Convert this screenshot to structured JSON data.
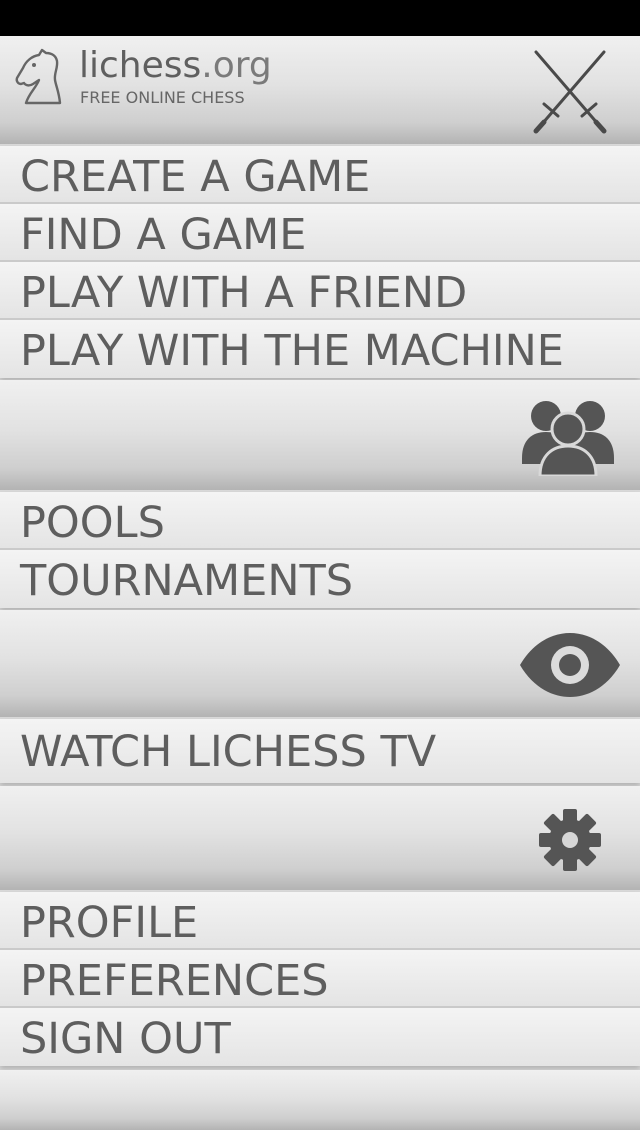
{
  "header": {
    "logo_name": "lichess",
    "logo_ext": ".org",
    "tagline": "FREE ONLINE CHESS",
    "logo_icon": "knight-icon",
    "action_icon": "crossed-swords-icon"
  },
  "play_menu": {
    "items": [
      {
        "label": "CREATE A GAME"
      },
      {
        "label": "FIND A GAME"
      },
      {
        "label": "PLAY WITH A FRIEND"
      },
      {
        "label": "PLAY WITH THE MACHINE"
      }
    ]
  },
  "community_section": {
    "icon": "users-icon",
    "items": [
      {
        "label": "POOLS"
      },
      {
        "label": "TOURNAMENTS"
      }
    ]
  },
  "watch_section": {
    "icon": "eye-icon",
    "items": [
      {
        "label": "WATCH LICHESS TV"
      }
    ]
  },
  "account_section": {
    "icon": "gear-icon",
    "items": [
      {
        "label": "PROFILE"
      },
      {
        "label": "PREFERENCES"
      },
      {
        "label": "SIGN OUT"
      }
    ]
  },
  "colors": {
    "text": "#5e5e5e",
    "icon": "#555555",
    "status_bar": "#000000"
  }
}
